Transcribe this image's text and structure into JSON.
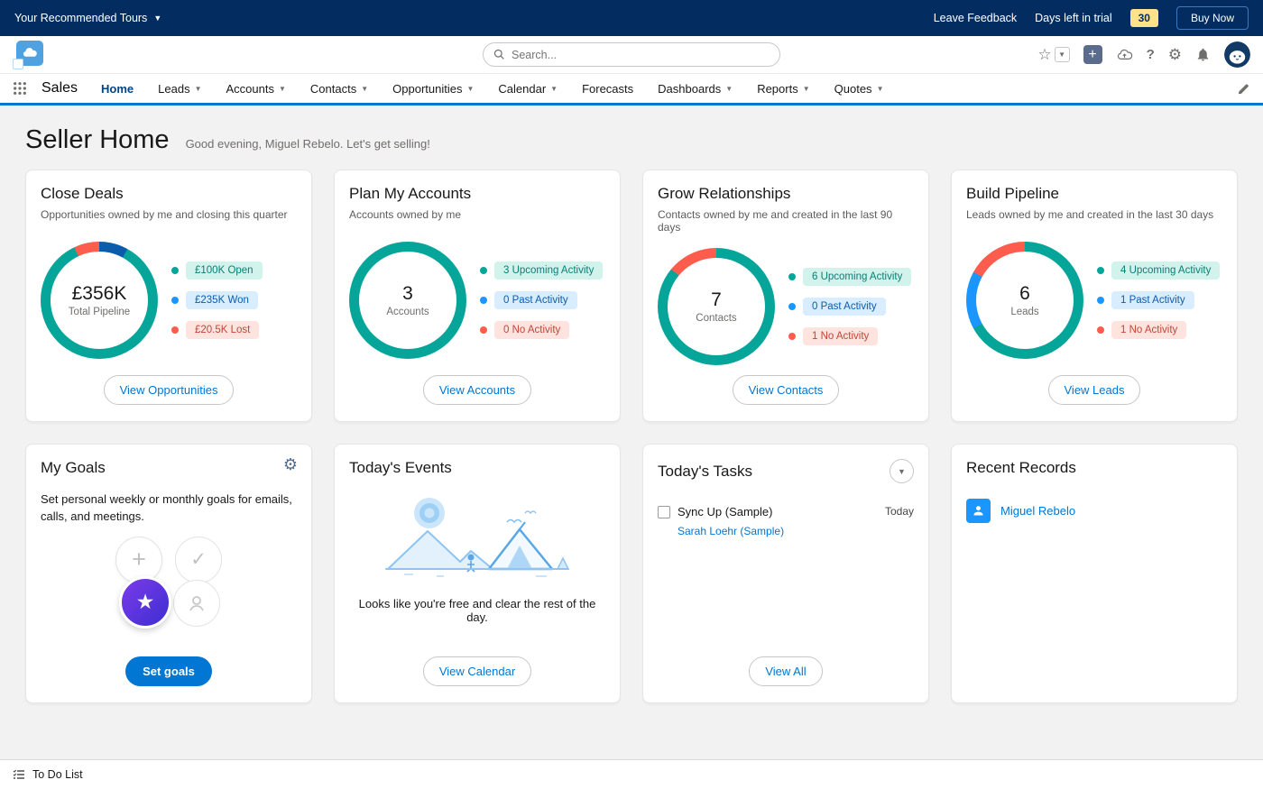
{
  "colors": {
    "brand_blue": "#0176D3",
    "dark_navy": "#032D60",
    "status_teal": "#06A59A",
    "status_blue": "#1B96FF",
    "status_red": "#FE5C4C",
    "won_navy": "#0B5CAB",
    "trial_badge_yellow": "#FFE28A",
    "goal_star_purple": "#5A2FE0",
    "link": "#0176D3"
  },
  "topbar": {
    "tours": "Your Recommended Tours",
    "leave_feedback": "Leave Feedback",
    "trial_label": "Days left in trial",
    "trial_days": "30",
    "buy_now": "Buy Now"
  },
  "header": {
    "search_placeholder": "Search...",
    "icons": [
      "favorites-star",
      "favorites-caret",
      "global-actions-plus",
      "cloud-upload",
      "help",
      "setup-gear",
      "notifications-bell",
      "user-avatar"
    ]
  },
  "nav": {
    "app_name": "Sales",
    "tabs": [
      {
        "label": "Home",
        "caret": false,
        "active": true
      },
      {
        "label": "Leads",
        "caret": true
      },
      {
        "label": "Accounts",
        "caret": true
      },
      {
        "label": "Contacts",
        "caret": true
      },
      {
        "label": "Opportunities",
        "caret": true
      },
      {
        "label": "Calendar",
        "caret": true
      },
      {
        "label": "Forecasts",
        "caret": false
      },
      {
        "label": "Dashboards",
        "caret": true
      },
      {
        "label": "Reports",
        "caret": true
      },
      {
        "label": "Quotes",
        "caret": true
      }
    ]
  },
  "page": {
    "title": "Seller Home",
    "greeting": "Good evening, Miguel Rebelo. Let's get selling!"
  },
  "cards": {
    "close_deals": {
      "title": "Close Deals",
      "subtitle": "Opportunities owned by me and closing this quarter",
      "center_value": "£356K",
      "center_label": "Total Pipeline",
      "legend": [
        {
          "label": "£100K Open",
          "color": "teal"
        },
        {
          "label": "£235K Won",
          "color": "blue"
        },
        {
          "label": "£20.5K Lost",
          "color": "red"
        }
      ],
      "button": "View Opportunities",
      "chart": {
        "type": "donut",
        "segments": [
          {
            "name": "Won",
            "color": "#0B5CAB",
            "pct": 8
          },
          {
            "name": "Open",
            "color": "#06A59A",
            "pct": 85
          },
          {
            "name": "Lost",
            "color": "#FE5C4C",
            "pct": 7
          }
        ]
      }
    },
    "plan_my_accounts": {
      "title": "Plan My Accounts",
      "subtitle": "Accounts owned by me",
      "center_value": "3",
      "center_label": "Accounts",
      "legend": [
        {
          "label": "3 Upcoming Activity",
          "color": "teal"
        },
        {
          "label": "0 Past Activity",
          "color": "blue"
        },
        {
          "label": "0 No Activity",
          "color": "red"
        }
      ],
      "button": "View Accounts",
      "chart": {
        "type": "donut",
        "segments": [
          {
            "name": "Upcoming Activity",
            "color": "#06A59A",
            "pct": 100
          }
        ]
      }
    },
    "grow_relationships": {
      "title": "Grow Relationships",
      "subtitle": "Contacts owned by me and created in the last 90 days",
      "center_value": "7",
      "center_label": "Contacts",
      "legend": [
        {
          "label": "6 Upcoming Activity",
          "color": "teal"
        },
        {
          "label": "0 Past Activity",
          "color": "blue"
        },
        {
          "label": "1 No Activity",
          "color": "red"
        }
      ],
      "button": "View Contacts",
      "chart": {
        "type": "donut",
        "segments": [
          {
            "name": "Upcoming Activity",
            "color": "#06A59A",
            "pct": 86
          },
          {
            "name": "No Activity",
            "color": "#FE5C4C",
            "pct": 14
          }
        ]
      }
    },
    "build_pipeline": {
      "title": "Build Pipeline",
      "subtitle": "Leads owned by me and created in the last 30 days",
      "center_value": "6",
      "center_label": "Leads",
      "legend": [
        {
          "label": "4 Upcoming Activity",
          "color": "teal"
        },
        {
          "label": "1 Past Activity",
          "color": "blue"
        },
        {
          "label": "1 No Activity",
          "color": "red"
        }
      ],
      "button": "View Leads",
      "chart": {
        "type": "donut",
        "segments": [
          {
            "name": "Upcoming Activity",
            "color": "#06A59A",
            "pct": 67
          },
          {
            "name": "Past Activity",
            "color": "#1B96FF",
            "pct": 16
          },
          {
            "name": "No Activity",
            "color": "#FE5C4C",
            "pct": 17
          }
        ]
      }
    },
    "my_goals": {
      "title": "My Goals",
      "description": "Set personal weekly or monthly goals for emails, calls, and meetings.",
      "button": "Set goals"
    },
    "todays_events": {
      "title": "Today's Events",
      "message": "Looks like you're free and clear the rest of the day.",
      "button": "View Calendar"
    },
    "todays_tasks": {
      "title": "Today's Tasks",
      "task": {
        "label": "Sync Up (Sample)",
        "due": "Today",
        "contact": "Sarah Loehr (Sample)"
      },
      "button": "View All"
    },
    "recent_records": {
      "title": "Recent Records",
      "items": [
        {
          "label": "Miguel Rebelo"
        }
      ]
    }
  },
  "footer": {
    "todo_label": "To Do List"
  }
}
